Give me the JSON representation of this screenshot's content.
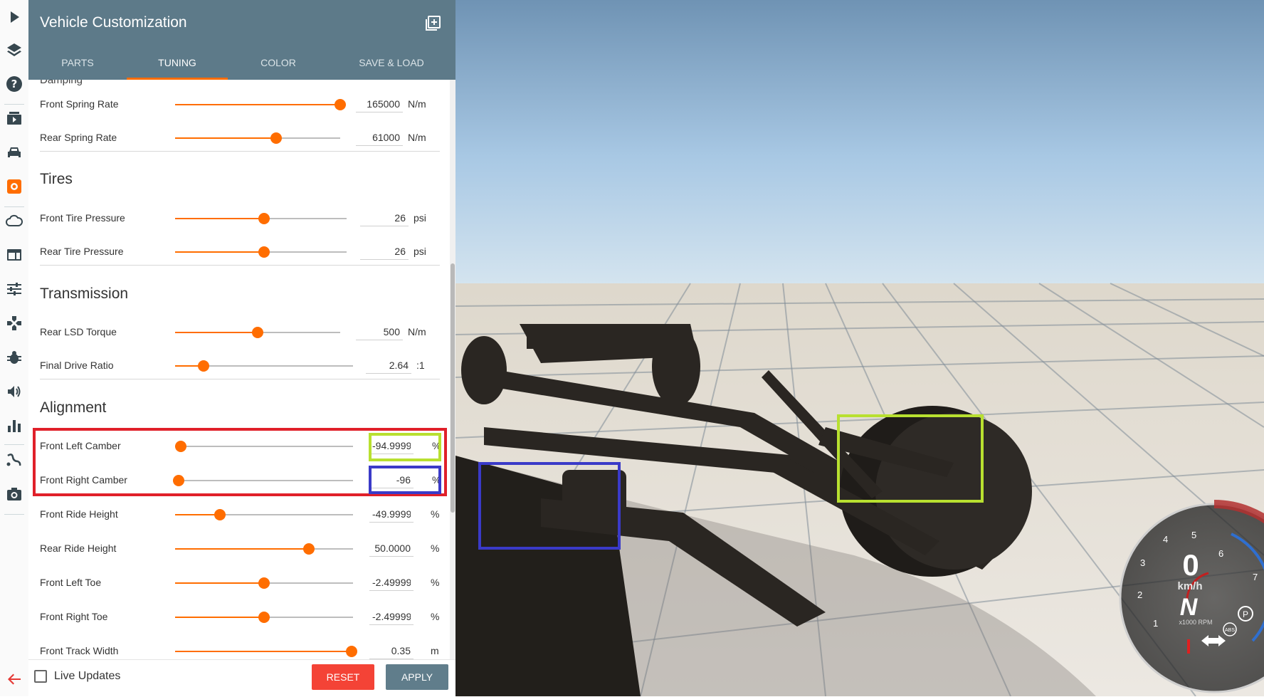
{
  "panel": {
    "title": "Vehicle Customization",
    "tabs": [
      {
        "label": "Parts"
      },
      {
        "label": "Tuning"
      },
      {
        "label": "Color"
      },
      {
        "label": "Save & Load"
      }
    ],
    "active_tab": "Tuning",
    "cut_off_label": "Damping",
    "sections": {
      "tires": "Tires",
      "transmission": "Transmission",
      "alignment": "Alignment"
    },
    "rows": [
      {
        "label": "Front Spring Rate",
        "value": "165000",
        "unit": "N/m",
        "level": 1.0
      },
      {
        "label": "Rear Spring Rate",
        "value": "61000",
        "unit": "N/m",
        "level": 0.61
      },
      {
        "label": "Front Tire Pressure",
        "value": "26",
        "unit": "psi",
        "level": 0.52
      },
      {
        "label": "Rear Tire Pressure",
        "value": "26",
        "unit": "psi",
        "level": 0.52
      },
      {
        "label": "Rear LSD Torque",
        "value": "500",
        "unit": "N/m",
        "level": 0.5
      },
      {
        "label": "Final Drive Ratio",
        "value": "2.64",
        "unit": ":1",
        "level": 0.16
      },
      {
        "label": "Front Left Camber",
        "value": "-94.9999",
        "unit": "%",
        "level": 0.03
      },
      {
        "label": "Front Right Camber",
        "value": "-96",
        "unit": "%",
        "level": 0.02
      },
      {
        "label": "Front Ride Height",
        "value": "-49.9999",
        "unit": "%",
        "level": 0.25
      },
      {
        "label": "Rear Ride Height",
        "value": "50.0000",
        "unit": "%",
        "level": 0.75
      },
      {
        "label": "Front Left Toe",
        "value": "-2.49999",
        "unit": "%",
        "level": 0.5
      },
      {
        "label": "Front Right Toe",
        "value": "-2.49999",
        "unit": "%",
        "level": 0.5
      },
      {
        "label": "Front Track Width",
        "value": "0.35",
        "unit": "m",
        "level": 0.99
      }
    ],
    "live_updates_label": "Live Updates",
    "live_updates_checked": false,
    "reset_label": "Reset",
    "apply_label": "Apply"
  },
  "rail": {
    "icons": [
      "play-icon",
      "layers-icon",
      "help-icon",
      "video-icon",
      "car-icon",
      "settings-gear-icon",
      "cloud-icon",
      "window-icon",
      "sliders-icon",
      "gamepad-icon",
      "bug-icon",
      "volume-icon",
      "bar-chart-icon",
      "path-icon",
      "camera-icon"
    ],
    "active_icon": "settings-gear-icon",
    "back_icon": "arrow-left-icon"
  },
  "hud": {
    "speed": "0",
    "speed_unit": "km/h",
    "gear": "N",
    "rpm_unit": "x1000 RPM",
    "rpm_ticks": [
      "1",
      "2",
      "3",
      "4",
      "5",
      "6",
      "7"
    ],
    "abs_label": "ABS",
    "parking_label": "P"
  },
  "colors": {
    "accent": "#ff6d00",
    "header": "#5d7a89",
    "reset": "#f44336",
    "apply": "#607d8b",
    "highlight_red": "#e0202a",
    "highlight_lime": "#b8e030",
    "highlight_blue": "#3a3ac8"
  }
}
